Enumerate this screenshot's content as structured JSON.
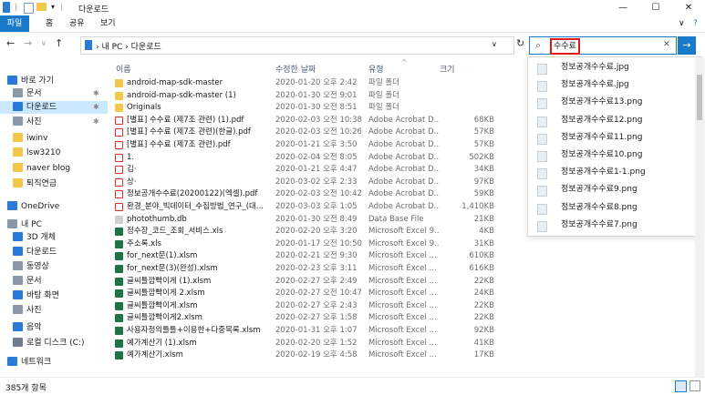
{
  "window": {
    "title": "다운로드",
    "minimize": "—",
    "maximize": "☐",
    "close": "✕"
  },
  "ribbon": {
    "tabs": [
      "파일",
      "홈",
      "공유",
      "보기"
    ],
    "help": "?",
    "expand": "∨"
  },
  "address": {
    "back": "←",
    "forward": "→",
    "recent": "∨",
    "up": "↑",
    "crumbs": "› 내 PC › 다운로드",
    "dropdown": "∨",
    "refresh": "↻"
  },
  "search": {
    "value": "수수료",
    "clear": "✕",
    "go": "→",
    "icon": "⌕"
  },
  "sidebar": [
    {
      "label": "바로 가기",
      "icon": "star-icon",
      "pinned": false
    },
    {
      "label": "문서",
      "icon": "document-icon",
      "pinned": true
    },
    {
      "label": "다운로드",
      "icon": "download-icon",
      "pinned": true,
      "selected": true
    },
    {
      "label": "사진",
      "icon": "picture-icon",
      "pinned": true
    },
    {
      "label": "iwinv",
      "icon": "folder-icon",
      "pinned": false
    },
    {
      "label": "lsw3210",
      "icon": "folder-icon",
      "pinned": false
    },
    {
      "label": "naver blog",
      "icon": "folder-icon",
      "pinned": false
    },
    {
      "label": "퇴직연금",
      "icon": "folder-icon",
      "pinned": false
    },
    {
      "label": "OneDrive",
      "icon": "cloud-icon",
      "pinned": false
    },
    {
      "label": "내 PC",
      "icon": "computer-icon",
      "pinned": false
    },
    {
      "label": "3D 개체",
      "icon": "cube-icon",
      "pinned": false
    },
    {
      "label": "다운로드",
      "icon": "download-icon",
      "pinned": false
    },
    {
      "label": "동영상",
      "icon": "video-icon",
      "pinned": false
    },
    {
      "label": "문서",
      "icon": "document-icon",
      "pinned": false
    },
    {
      "label": "바탕 화면",
      "icon": "desktop-icon",
      "pinned": false
    },
    {
      "label": "사진",
      "icon": "picture-icon",
      "pinned": false
    },
    {
      "label": "음악",
      "icon": "music-icon",
      "pinned": false
    },
    {
      "label": "로컬 디스크 (C:)",
      "icon": "drive-icon",
      "pinned": false
    },
    {
      "label": "네트워크",
      "icon": "network-icon",
      "pinned": false
    }
  ],
  "columns": {
    "name": "이름",
    "date": "수정한 날짜",
    "type": "유형",
    "size": "크기",
    "sort_arrow": "^"
  },
  "files": [
    {
      "name": "android-map-sdk-master",
      "date": "2020-01-20 오후 2:42",
      "type": "파일 폴더",
      "size": "",
      "kind": "folder"
    },
    {
      "name": "android-map-sdk-master (1)",
      "date": "2020-01-30 오전 9:01",
      "type": "파일 폴더",
      "size": "",
      "kind": "folder"
    },
    {
      "name": "Originals",
      "date": "2020-01-30 오전 8:51",
      "type": "파일 폴더",
      "size": "",
      "kind": "folder"
    },
    {
      "name": "[별표] 수수료 (제7조 관련) (1).pdf",
      "date": "2020-02-03 오전 10:38",
      "type": "Adobe Acrobat D...",
      "size": "68KB",
      "kind": "pdf"
    },
    {
      "name": "[별표] 수수료 (제7조 관련)(한글).pdf",
      "date": "2020-02-03 오전 10:26",
      "type": "Adobe Acrobat D...",
      "size": "57KB",
      "kind": "pdf"
    },
    {
      "name": "[별표] 수수료 (제7조 관련).pdf",
      "date": "2020-01-21 오후 3:50",
      "type": "Adobe Acrobat D...",
      "size": "57KB",
      "kind": "pdf"
    },
    {
      "name": "1.",
      "date": "2020-02-04 오전 8:05",
      "type": "Adobe Acrobat D...",
      "size": "502KB",
      "kind": "pdf"
    },
    {
      "name": "김·",
      "date": "2020-01-21 오후 4:47",
      "type": "Adobe Acrobat D...",
      "size": "34KB",
      "kind": "pdf"
    },
    {
      "name": "상·",
      "date": "2020-03-02 오후 2:33",
      "type": "Adobe Acrobat D...",
      "size": "97KB",
      "kind": "pdf"
    },
    {
      "name": "정보공개수수료(20200122)(엑셀).pdf",
      "date": "2020-02-03 오전 10:42",
      "type": "Adobe Acrobat D...",
      "size": "59KB",
      "kind": "pdf"
    },
    {
      "name": "환경_분야_빅데이터_수집방법_연구_(대...",
      "date": "2020-03-03 오후 1:05",
      "type": "Adobe Acrobat D...",
      "size": "1,410KB",
      "kind": "pdf"
    },
    {
      "name": "photothumb.db",
      "date": "2020-01-30 오전 8:49",
      "type": "Data Base File",
      "size": "21KB",
      "kind": "db"
    },
    {
      "name": "정수장_코드_조회_서비스.xls",
      "date": "2020-02-20 오후 3:20",
      "type": "Microsoft Excel 9...",
      "size": "4KB",
      "kind": "xls"
    },
    {
      "name": "주소록.xls",
      "date": "2020-01-17 오전 10:50",
      "type": "Microsoft Excel 9...",
      "size": "31KB",
      "kind": "xls"
    },
    {
      "name": "for_next문(1).xlsm",
      "date": "2020-02-21 오전 9:30",
      "type": "Microsoft Excel ...",
      "size": "610KB",
      "kind": "xls"
    },
    {
      "name": "for_next문(3)(완성).xlsm",
      "date": "2020-02-23 오후 3:11",
      "type": "Microsoft Excel ...",
      "size": "616KB",
      "kind": "xls"
    },
    {
      "name": "글씨틀깜빡이게 (1).xlsm",
      "date": "2020-02-27 오후 2:49",
      "type": "Microsoft Excel ...",
      "size": "22KB",
      "kind": "xls"
    },
    {
      "name": "글씨틀깜빡이게 2.xlsm",
      "date": "2020-02-27 오전 10:47",
      "type": "Microsoft Excel ...",
      "size": "24KB",
      "kind": "xls"
    },
    {
      "name": "글씨틀깜빡이게.xlsm",
      "date": "2020-02-27 오후 2:43",
      "type": "Microsoft Excel ...",
      "size": "22KB",
      "kind": "xls"
    },
    {
      "name": "글씨틀깜빡이게2.xlsm",
      "date": "2020-02-27 오후 1:58",
      "type": "Microsoft Excel ...",
      "size": "22KB",
      "kind": "xls"
    },
    {
      "name": "사용자정의틀틀+이용한+다중목록.xlsm",
      "date": "2020-01-31 오후 1:07",
      "type": "Microsoft Excel ...",
      "size": "92KB",
      "kind": "xls"
    },
    {
      "name": "예가계산기 (1).xlsm",
      "date": "2020-02-20 오후 1:52",
      "type": "Microsoft Excel ...",
      "size": "41KB",
      "kind": "xls"
    },
    {
      "name": "예가계산기.xlsm",
      "date": "2020-02-19 오후 4:58",
      "type": "Microsoft Excel ...",
      "size": "17KB",
      "kind": "xls"
    }
  ],
  "suggestions": [
    "정보공개수수료.jpg",
    "정보공개수수료.jpg",
    "정보공개수수료13.png",
    "정보공개수수료12.png",
    "정보공개수수료11.png",
    "정보공개수수료10.png",
    "정보공개수수료1-1.png",
    "정보공개수수료9.png",
    "정보공개수수료8.png",
    "정보공개수수료7.png"
  ],
  "status": {
    "count": "385개 항목"
  }
}
